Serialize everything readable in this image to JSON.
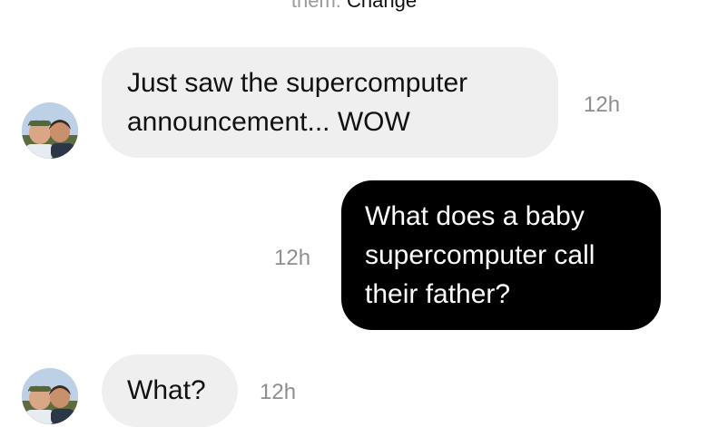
{
  "header_notice": {
    "muted_text": "them.",
    "link_text": "Change"
  },
  "messages": [
    {
      "direction": "incoming",
      "lines": [
        "Just saw the supercomputer",
        "announcement... WOW"
      ],
      "timestamp": "12h",
      "avatar": "avatar-icon"
    },
    {
      "direction": "outgoing",
      "lines": [
        "What does a baby",
        "supercomputer call",
        "their father?"
      ],
      "timestamp": "12h"
    },
    {
      "direction": "incoming",
      "lines": [
        "What?"
      ],
      "timestamp": "12h",
      "avatar": "avatar-icon"
    }
  ],
  "colors": {
    "incoming_bubble": "#efefef",
    "outgoing_bubble": "#000000",
    "timestamp": "#8e8e8e",
    "muted": "#9a9a9a"
  }
}
